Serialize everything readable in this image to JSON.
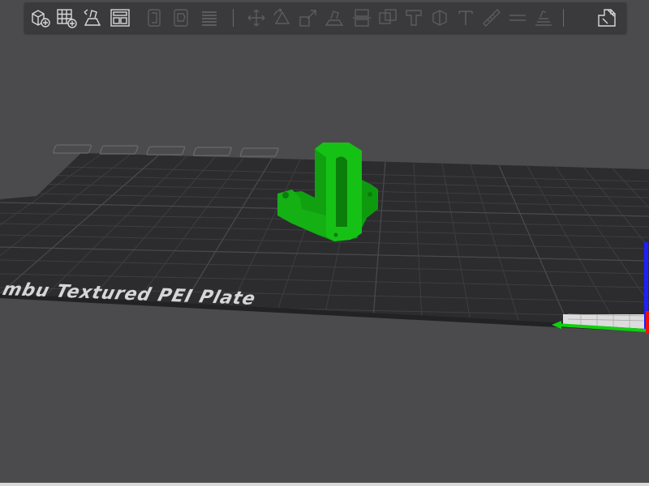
{
  "toolbar": {
    "groups": [
      [
        "add-object",
        "add-plate",
        "auto-orient",
        "arrange"
      ],
      [
        "split-to-objects",
        "split-to-parts",
        "layers"
      ],
      [
        "move",
        "rotate",
        "scale",
        "lay-on-face",
        "cut",
        "mesh-boolean",
        "support-paint",
        "seam-paint",
        "text",
        "measure",
        "assembly",
        "variable-layer-height"
      ],
      [
        "assembly-view"
      ]
    ]
  },
  "plate": {
    "label": "mbu Textured PEI Plate"
  },
  "colors": {
    "background": "#4b4b4d",
    "toolbar_bg": "#3a3a3c",
    "plate_surface": "#2c2c2e",
    "grid_line": "#3e3e40",
    "model_green": "#14b814",
    "icon_active": "#d8d8d8",
    "icon_disabled": "#5c5c5e"
  }
}
